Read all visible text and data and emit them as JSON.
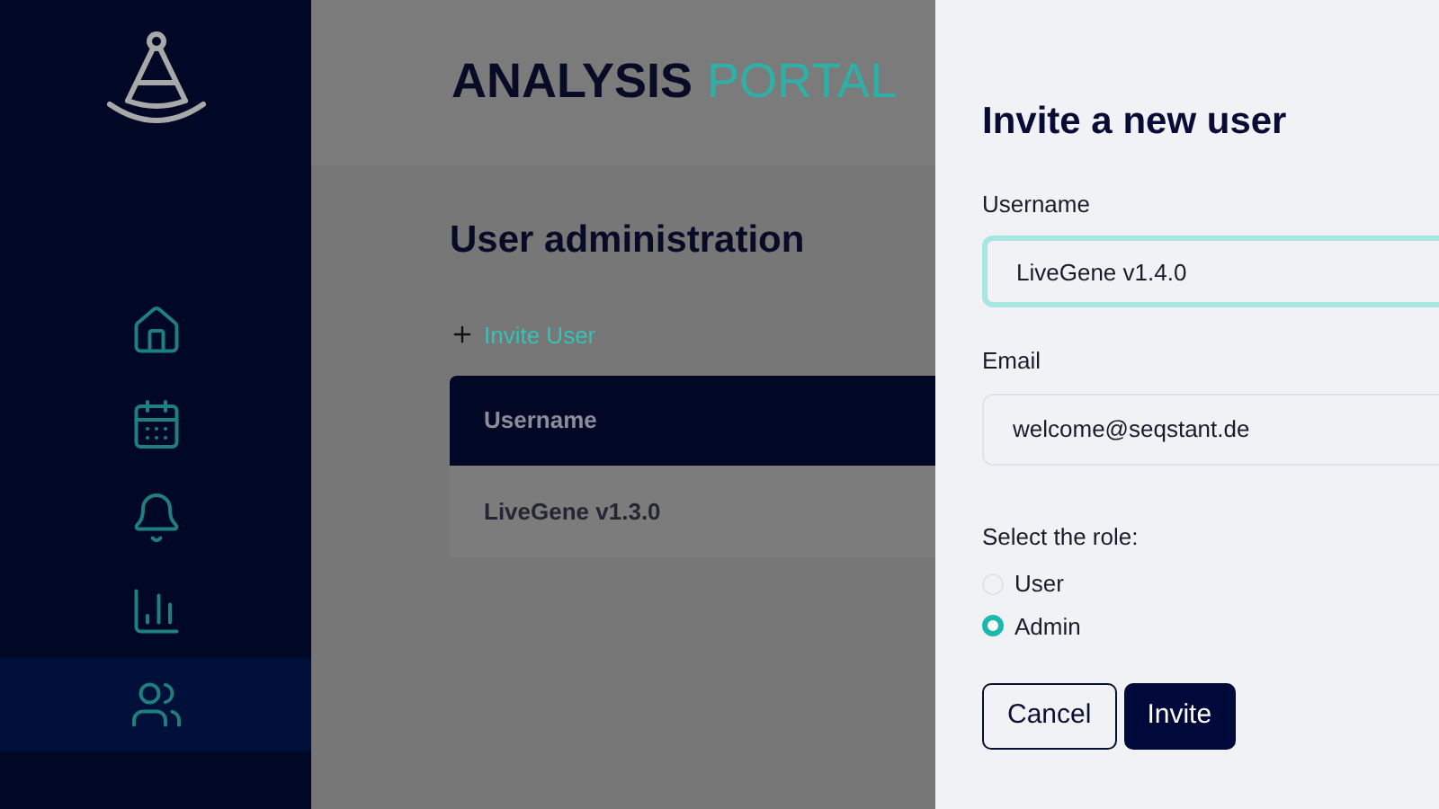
{
  "sidebar": {
    "items": [
      {
        "kind": "home",
        "selected": false
      },
      {
        "kind": "calendar",
        "selected": false
      },
      {
        "kind": "bell",
        "selected": false
      },
      {
        "kind": "chart",
        "selected": false
      },
      {
        "kind": "users",
        "selected": true
      }
    ]
  },
  "header": {
    "title_strong": "ANALYSIS",
    "title_light": "PORTAL"
  },
  "page": {
    "heading": "User administration",
    "invite_link": "Invite User",
    "table": {
      "columns": [
        "Username"
      ],
      "rows": [
        [
          "LiveGene v1.3.0"
        ]
      ]
    }
  },
  "drawer": {
    "title": "Invite a new user",
    "fields": [
      {
        "label": "Username",
        "value": "LiveGene v1.4.0",
        "focused": true
      },
      {
        "label": "Email",
        "value": "welcome@seqstant.de",
        "focused": false
      }
    ],
    "role_label": "Select the role:",
    "roles": [
      {
        "label": "User",
        "selected": false
      },
      {
        "label": "Admin",
        "selected": true
      }
    ],
    "buttons": [
      {
        "label": "Cancel",
        "kind": "secondary"
      },
      {
        "label": "Invite",
        "kind": "primary"
      }
    ]
  }
}
